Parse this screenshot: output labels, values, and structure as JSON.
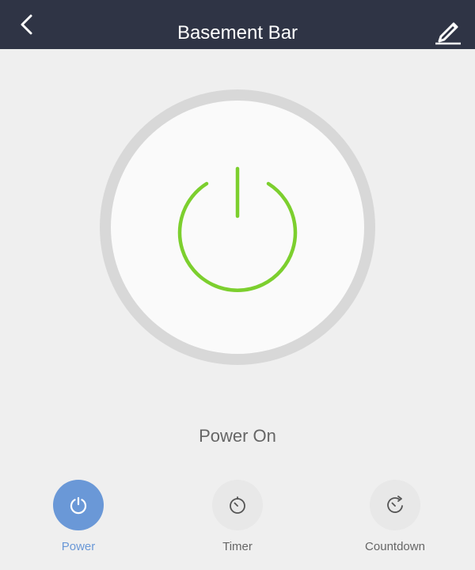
{
  "header": {
    "title": "Basement Bar",
    "back_icon": "chevron-left-icon",
    "edit_icon": "pencil-icon"
  },
  "device": {
    "power_icon": "power-icon",
    "status_text": "Power On",
    "power_color": "#7ccf2e"
  },
  "actions": [
    {
      "label": "Power",
      "icon": "power-icon",
      "active": true
    },
    {
      "label": "Timer",
      "icon": "timer-icon",
      "active": false
    },
    {
      "label": "Countdown",
      "icon": "countdown-icon",
      "active": false
    }
  ],
  "colors": {
    "header_bg": "#2f3445",
    "background": "#efefef",
    "active_blue": "#6a98d7",
    "power_green": "#7ccf2e",
    "inactive_gray": "#666666"
  }
}
